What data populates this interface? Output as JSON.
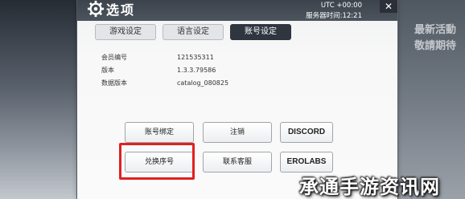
{
  "window": {
    "title": "选项",
    "clock": {
      "line1": "UTC +00:00",
      "line2": "服务器时间:12:21"
    },
    "close_symbol": "✕"
  },
  "tabs": [
    {
      "label": "游戏设定",
      "active": false
    },
    {
      "label": "语言设定",
      "active": false
    },
    {
      "label": "账号设定",
      "active": true
    }
  ],
  "account_info": [
    {
      "label": "会员编号",
      "value": "121535311"
    },
    {
      "label": "版本",
      "value": "1.3.3.79586"
    },
    {
      "label": "数据版本",
      "value": "catalog_080825"
    }
  ],
  "buttons": {
    "bind_account": "账号绑定",
    "logout": "注销",
    "discord": "DISCORD",
    "redeem_code": "兑换序号",
    "contact_support": "联系客服",
    "erolabs": "EROLABS"
  },
  "background": {
    "sign_line1": "最新活動",
    "sign_line2": "敬請期待"
  },
  "watermark": "承通手游资讯网",
  "colors": {
    "highlight": "#e02020",
    "active_tab": "#2f3640",
    "titlebar": "#3c434c"
  },
  "icons": {
    "title": "gear-icon",
    "close": "close-icon"
  }
}
